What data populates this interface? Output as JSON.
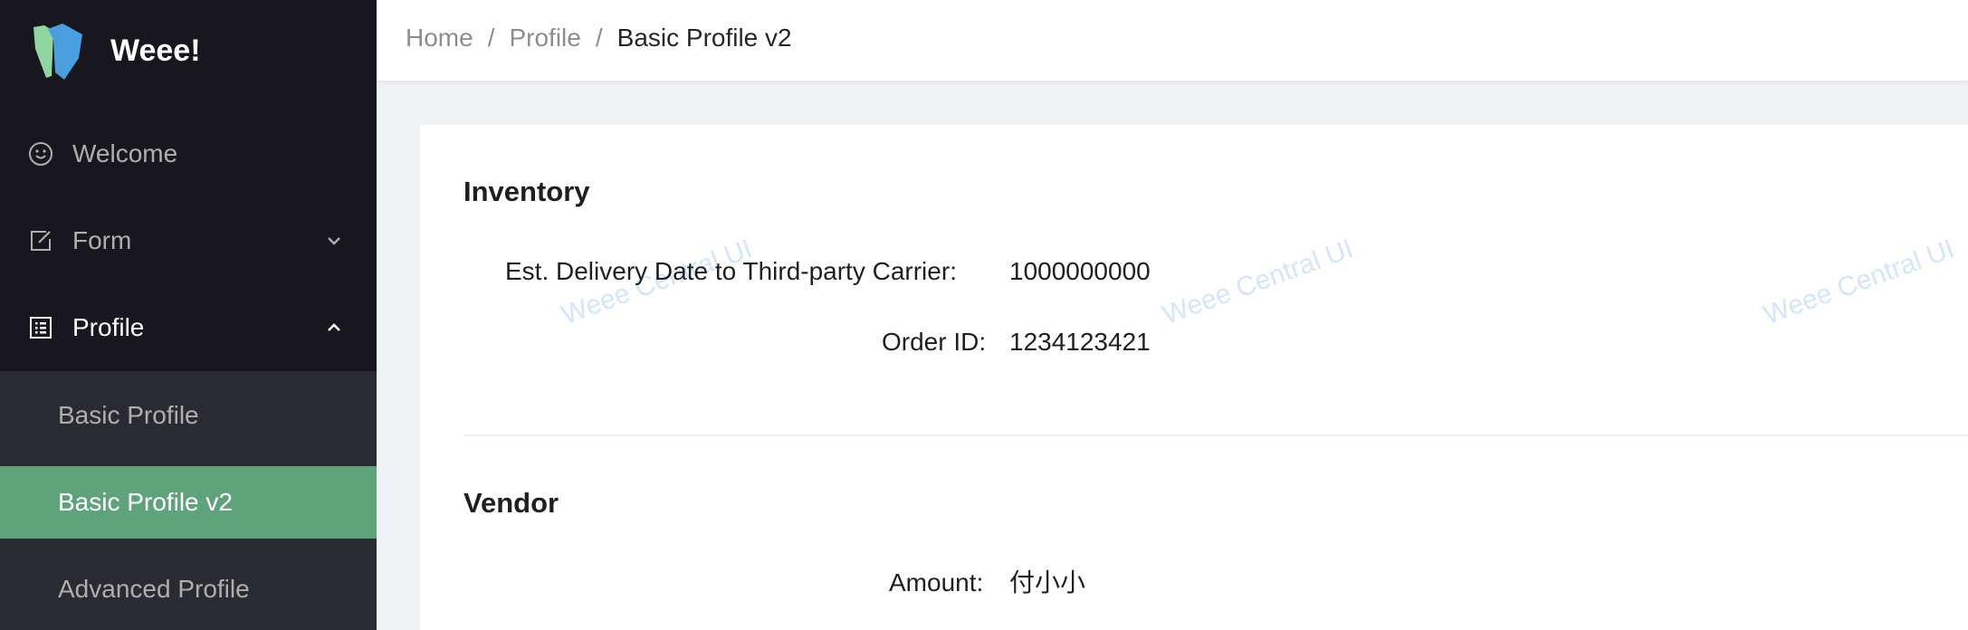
{
  "app": {
    "name": "Weee!",
    "colors": {
      "sidebar_bg": "#18171d",
      "submenu_bg": "#2a2a31",
      "selected_bg": "#5ea37b",
      "logo_green": "#8fd6a0",
      "logo_blue": "#4a9fe0"
    }
  },
  "sidebar": {
    "items": [
      {
        "label": "Welcome",
        "icon": "smile-icon"
      },
      {
        "label": "Form",
        "icon": "edit-icon",
        "arrow": "chevron-down-icon"
      },
      {
        "label": "Profile",
        "icon": "profile-icon",
        "arrow": "chevron-up-icon"
      }
    ],
    "profile_submenu": [
      {
        "label": "Basic Profile"
      },
      {
        "label": "Basic Profile v2",
        "selected": true
      },
      {
        "label": "Advanced Profile"
      }
    ]
  },
  "header": {
    "breadcrumb": [
      "Home",
      "Profile",
      "Basic Profile v2"
    ],
    "separator": "/"
  },
  "watermark": {
    "text": "Weee Central UI"
  },
  "sections": {
    "inventory": {
      "title": "Inventory",
      "rows": [
        {
          "label": "Est. Delivery Date to Third-party Carrier",
          "value": "1000000000"
        },
        {
          "label": "Order ID",
          "value": "1234123421"
        }
      ]
    },
    "vendor": {
      "title": "Vendor",
      "rows": [
        {
          "label": "Amount",
          "value": "付小小"
        }
      ]
    }
  },
  "label_suffix": ":"
}
